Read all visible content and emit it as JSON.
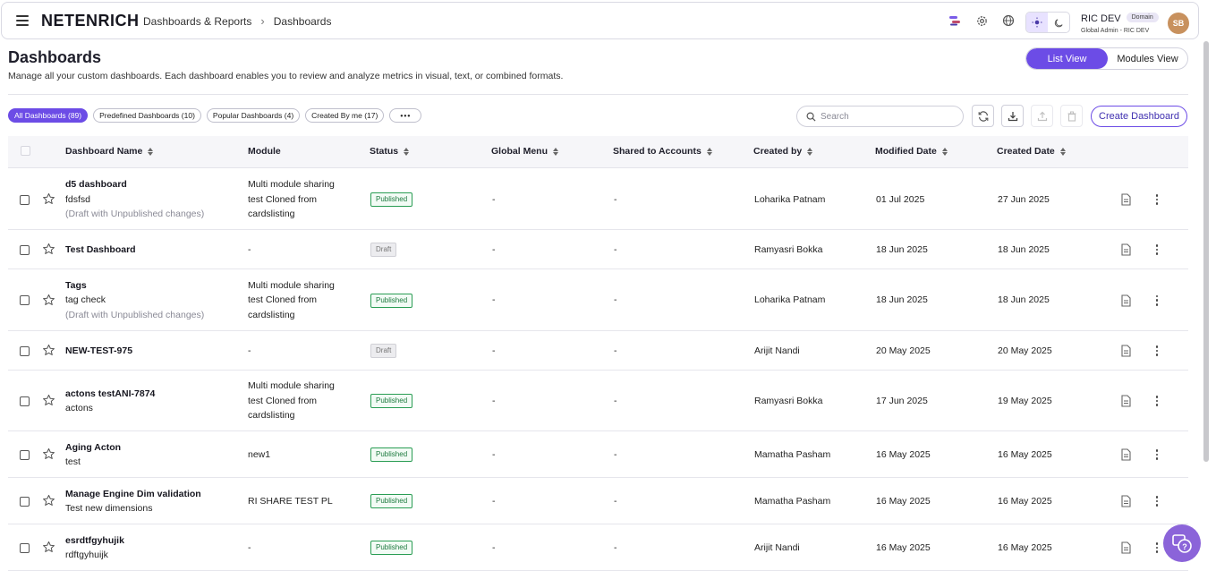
{
  "header": {
    "logo": "NETENRICH",
    "breadcrumb": [
      "Dashboards & Reports",
      "Dashboards"
    ],
    "user_name": "RIC DEV",
    "user_badge": "Domain",
    "user_role": "Global Admin - RIC DEV",
    "avatar_initials": "SB"
  },
  "page": {
    "title": "Dashboards",
    "subtitle": "Manage all your custom dashboards. Each dashboard enables you to review and analyze metrics in visual, text, or combined formats.",
    "list_view_label": "List View",
    "modules_view_label": "Modules View"
  },
  "filters": {
    "chips": [
      "All Dashboards (89)",
      "Predefined Dashboards (10)",
      "Popular Dashboards (4)",
      "Created By me (17)"
    ],
    "more": "•••"
  },
  "toolbar": {
    "search_placeholder": "Search",
    "create_label": "Create Dashboard"
  },
  "table": {
    "headers": [
      "Dashboard Name",
      "Module",
      "Status",
      "Global Menu",
      "Shared to Accounts",
      "Created by",
      "Modified Date",
      "Created Date"
    ],
    "rows": [
      {
        "name": "d5 dashboard",
        "desc": "fdsfsd",
        "note": "(Draft with Unpublished changes)",
        "module": [
          "Multi module sharing",
          "test Cloned from",
          "cardslisting"
        ],
        "status": "Published",
        "global_menu": "-",
        "shared": "-",
        "created_by": "Loharika Patnam",
        "modified": "01 Jul 2025",
        "created": "27 Jun 2025"
      },
      {
        "name": "Test Dashboard",
        "desc": "",
        "note": "",
        "module": [
          "-"
        ],
        "status": "Draft",
        "global_menu": "-",
        "shared": "-",
        "created_by": "Ramyasri Bokka",
        "modified": "18 Jun 2025",
        "created": "18 Jun 2025"
      },
      {
        "name": "Tags",
        "desc": "tag check",
        "note": "(Draft with Unpublished changes)",
        "module": [
          "Multi module sharing",
          "test Cloned from",
          "cardslisting"
        ],
        "status": "Published",
        "global_menu": "-",
        "shared": "-",
        "created_by": "Loharika Patnam",
        "modified": "18 Jun 2025",
        "created": "18 Jun 2025"
      },
      {
        "name": "NEW-TEST-975",
        "desc": "",
        "note": "",
        "module": [
          "-"
        ],
        "status": "Draft",
        "global_menu": "-",
        "shared": "-",
        "created_by": "Arijit Nandi",
        "modified": "20 May 2025",
        "created": "20 May 2025"
      },
      {
        "name": "actons testANI-7874",
        "desc": "actons",
        "note": "",
        "module": [
          "Multi module sharing",
          "test Cloned from",
          "cardslisting"
        ],
        "status": "Published",
        "global_menu": "-",
        "shared": "-",
        "created_by": "Ramyasri Bokka",
        "modified": "17 Jun 2025",
        "created": "19 May 2025"
      },
      {
        "name": "Aging Acton",
        "desc": "test",
        "note": "",
        "module": [
          "new1"
        ],
        "status": "Published",
        "global_menu": "-",
        "shared": "-",
        "created_by": "Mamatha Pasham",
        "modified": "16 May 2025",
        "created": "16 May 2025"
      },
      {
        "name": "Manage Engine Dim validation",
        "desc": "Test new dimensions",
        "note": "",
        "module": [
          "RI SHARE TEST PL"
        ],
        "status": "Published",
        "global_menu": "-",
        "shared": "-",
        "created_by": "Mamatha Pasham",
        "modified": "16 May 2025",
        "created": "16 May 2025"
      },
      {
        "name": "esrdtfgyhujik",
        "desc": "rdftgyhuijk",
        "note": "",
        "module": [
          "-"
        ],
        "status": "Published",
        "global_menu": "-",
        "shared": "-",
        "created_by": "Arijit Nandi",
        "modified": "16 May 2025",
        "created": "16 May 2025"
      }
    ]
  },
  "colors": {
    "accent": "#6c4ce6",
    "published": "#2a9d54",
    "draft": "#777777",
    "avatar": "#c8915e"
  }
}
